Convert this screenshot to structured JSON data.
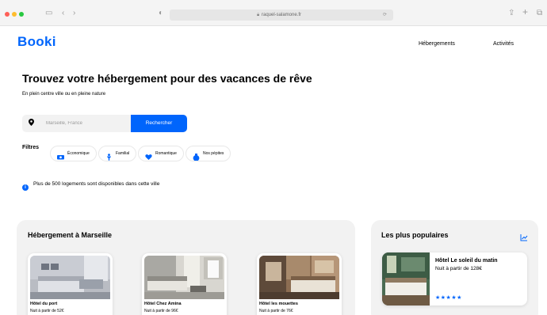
{
  "browser": {
    "url": "raquel-salamone.fr"
  },
  "header": {
    "logo": "Booki",
    "nav": [
      "Hébergements",
      "Activités"
    ]
  },
  "hero": {
    "title": "Trouvez votre hébergement pour des vacances de rêve",
    "subtitle": "En plein centre ville ou en pleine nature"
  },
  "search": {
    "placeholder": "Marseille, France",
    "button": "Rechercher"
  },
  "filters": {
    "title": "Filtres",
    "items": [
      {
        "label": "Économique",
        "icon": "money-icon"
      },
      {
        "label": "Familial",
        "icon": "child-icon"
      },
      {
        "label": "Romantique",
        "icon": "heart-icon"
      },
      {
        "label": "Nos pépites",
        "icon": "gem-icon"
      }
    ]
  },
  "info": {
    "text": "Plus de 500 logements sont disponibles dans cette ville"
  },
  "hebergements": {
    "title": "Hébergement à Marseille",
    "cards": [
      {
        "name": "Hôtel du port",
        "price": "Nuit à partir de 52€"
      },
      {
        "name": "Hôtel Chez Amina",
        "price": "Nuit à partir de 96€"
      },
      {
        "name": "Hôtel les mouettes",
        "price": "Nuit à partir de 76€"
      }
    ]
  },
  "populaires": {
    "title": "Les plus populaires",
    "cards": [
      {
        "name": "Hôtel Le soleil du matin",
        "price": "Nuit à partir de 128€",
        "rating": "★★★★★"
      }
    ]
  },
  "colors": {
    "accent": "#0065fc",
    "section_bg": "#f2f2f2"
  }
}
